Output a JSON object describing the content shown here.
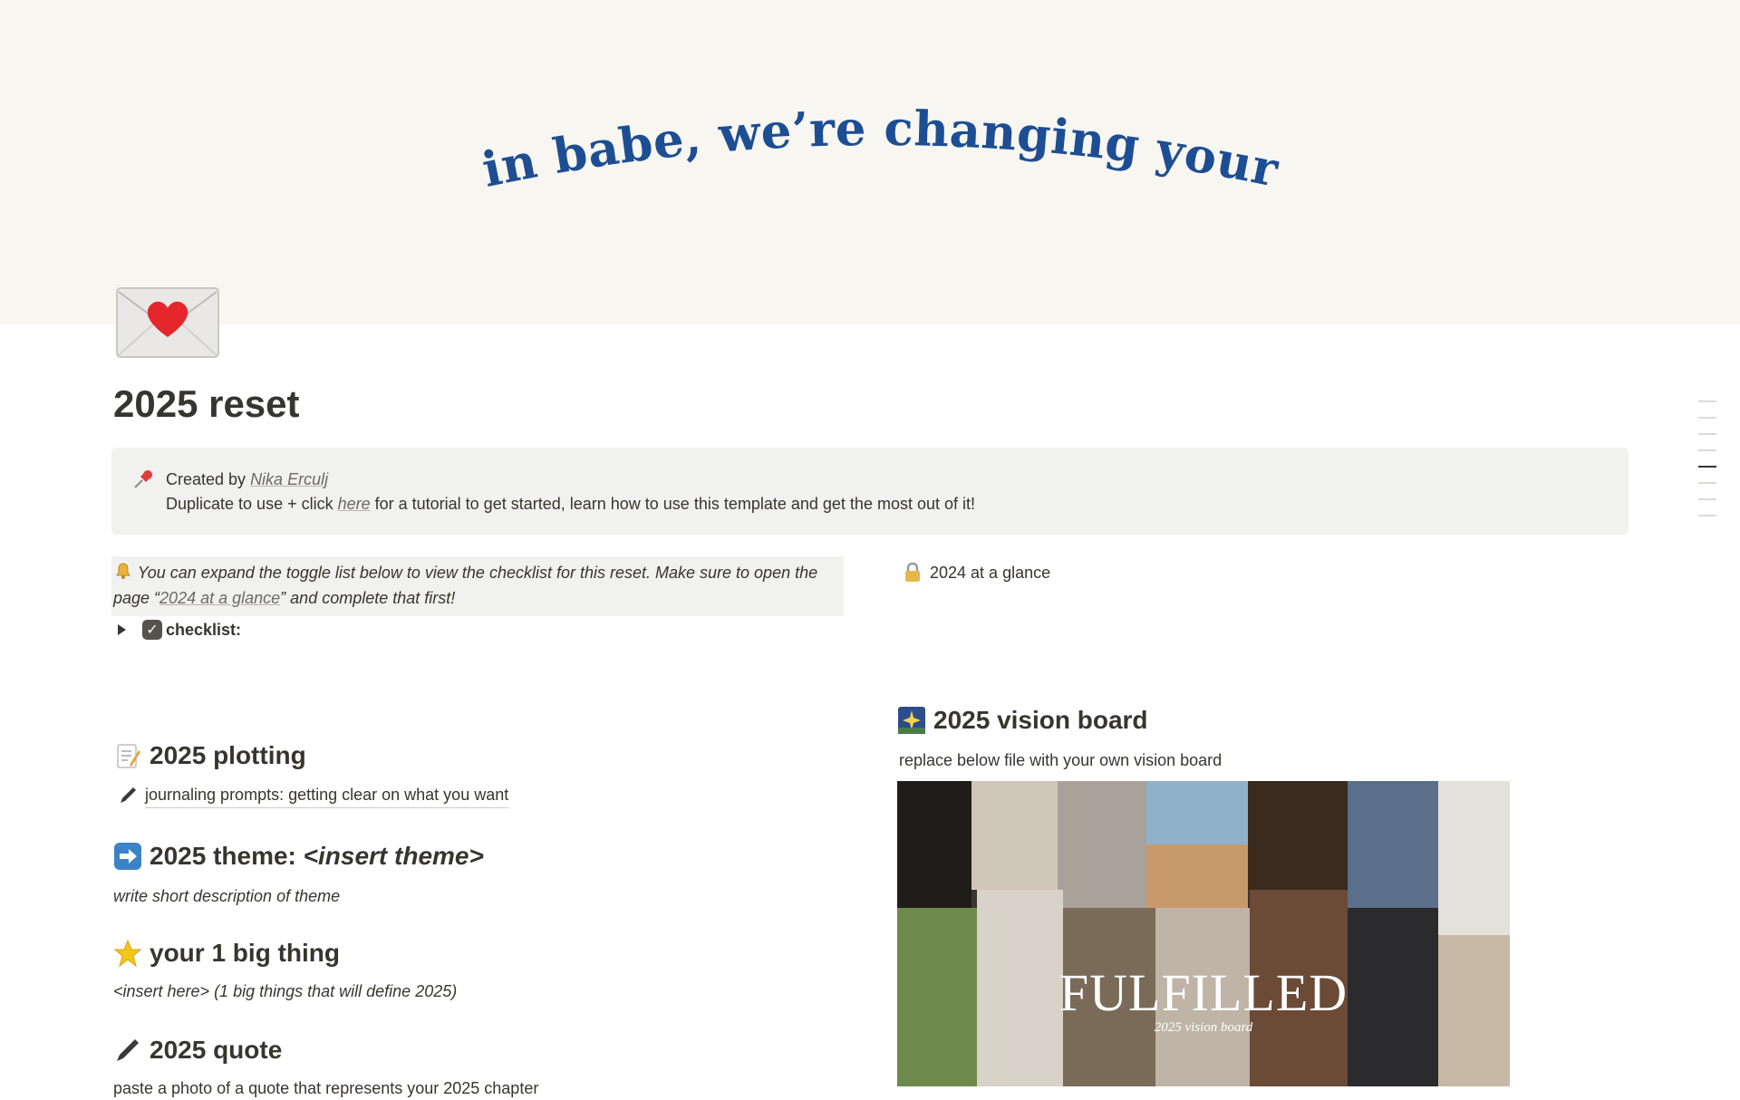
{
  "cover": {
    "text": "get in babe, we’re changing your life",
    "background": "#f8f6f0",
    "text_color": "#1d4e94"
  },
  "page": {
    "icon": "envelope-with-heart-icon",
    "title": "2025 reset"
  },
  "callout": {
    "icon": "pushpin-icon",
    "created_prefix": "Created by ",
    "author": "Nika Erculj",
    "line2_prefix": "Duplicate to use + click ",
    "line2_link": "here",
    "line2_suffix": " for a tutorial to get started, learn how to use this template and get the most out of it!"
  },
  "note": {
    "icon": "bell-icon",
    "text_before": "You can expand the toggle list below to view the checklist for this reset. Make sure to open the page “",
    "link": "2024 at a glance",
    "text_after": "” and complete that first!"
  },
  "toggle": {
    "icon": "check-box-icon",
    "label": "checklist:"
  },
  "linked_page": {
    "icon": "lock-icon",
    "label": "2024 at a glance"
  },
  "sections": {
    "plotting": {
      "icon": "memo-icon",
      "title": "2025 plotting",
      "sub_icon": "pen-icon",
      "sub": "journaling prompts: getting clear on what you want"
    },
    "theme": {
      "icon": "right-arrow-icon",
      "title_prefix": "2025 theme: ",
      "title_italic": "<insert theme>",
      "sub": "write short description of theme"
    },
    "big_thing": {
      "icon": "star-icon",
      "title": "your 1 big thing",
      "sub": "<insert here>  (1 big things that will define 2025)"
    },
    "quote": {
      "icon": "pen-icon",
      "title": "2025 quote",
      "sub": "paste a photo of a quote that represents your 2025 chapter"
    },
    "vision": {
      "icon": "night-sky-icon",
      "title": "2025 vision board",
      "sub": "replace below file with your own vision board",
      "board_title": "FULFILLED",
      "board_sub": "2025 vision board"
    }
  }
}
